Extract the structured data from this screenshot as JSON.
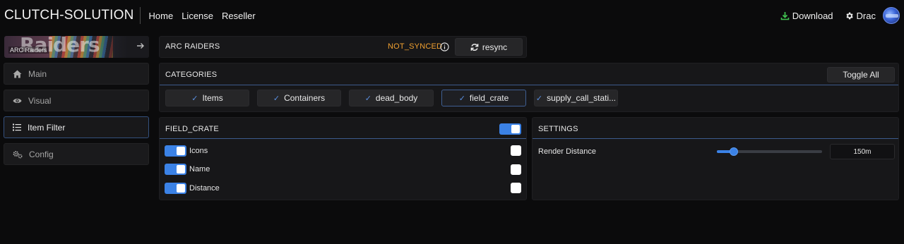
{
  "brand": "CLUTCH-SOLUTION",
  "nav": {
    "links": [
      "Home",
      "License",
      "Reseller"
    ],
    "download_label": "Download",
    "user_label": "Drac"
  },
  "sidebar": {
    "game": {
      "name": "ARC Raiders",
      "art_text": "ARC Raiders"
    },
    "items": [
      {
        "label": "Main",
        "icon": "home-icon",
        "active": false
      },
      {
        "label": "Visual",
        "icon": "eye-icon",
        "active": false
      },
      {
        "label": "Item Filter",
        "icon": "list-icon",
        "active": true
      },
      {
        "label": "Config",
        "icon": "gears-icon",
        "active": false
      }
    ]
  },
  "game_panel": {
    "title": "ARC RAIDERS",
    "status": "NOT_SYNCED",
    "status_color": "#f0a030",
    "resync_label": "resync"
  },
  "categories": {
    "title": "CATEGORIES",
    "toggle_all_label": "Toggle All",
    "chips": [
      {
        "label": "Items",
        "checked": true,
        "selected": false
      },
      {
        "label": "Containers",
        "checked": true,
        "selected": false
      },
      {
        "label": "dead_body",
        "checked": true,
        "selected": false
      },
      {
        "label": "field_crate",
        "checked": true,
        "selected": true
      },
      {
        "label": "supply_call_stati...",
        "checked": true,
        "selected": false
      }
    ]
  },
  "field_crate": {
    "title": "FIELD_CRATE",
    "enabled": true,
    "options": [
      {
        "label": "Icons",
        "enabled": true,
        "checkbox": false
      },
      {
        "label": "Name",
        "enabled": true,
        "checkbox": false
      },
      {
        "label": "Distance",
        "enabled": true,
        "checkbox": false
      }
    ]
  },
  "settings": {
    "title": "SETTINGS",
    "render_distance_label": "Render Distance",
    "render_distance_value": "150m",
    "render_distance_fraction": 0.16
  },
  "colors": {
    "accent": "#3b82e6",
    "warning": "#f0a030",
    "download_icon": "#3fbf4f",
    "background": "#0b0b0c",
    "panel": "#171719"
  }
}
